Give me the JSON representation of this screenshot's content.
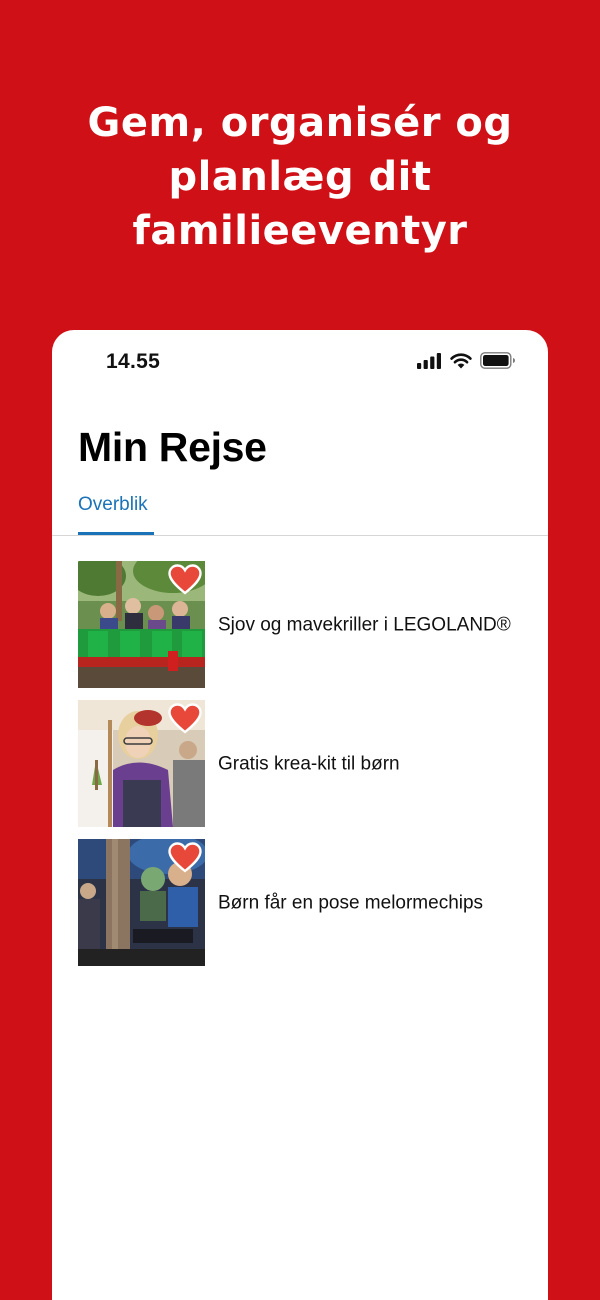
{
  "promo": {
    "headline_lines": [
      "Gem, organisér og",
      "planlæg dit",
      "familieeventyr"
    ]
  },
  "statusbar": {
    "time": "14.55",
    "icons": [
      "signal-icon",
      "wifi-icon",
      "battery-icon"
    ]
  },
  "screen": {
    "title": "Min Rejse",
    "tabs": [
      {
        "label": "Overblik",
        "active": true
      }
    ]
  },
  "saved_items": [
    {
      "title": "Sjov og mavekriller i LEGOLAND®",
      "favorited": true,
      "image": "rollercoaster-photo"
    },
    {
      "title": "Gratis krea-kit til børn",
      "favorited": true,
      "image": "girl-painting-photo"
    },
    {
      "title": "Børn får en pose melormechips",
      "favorited": true,
      "image": "children-forest-photo"
    }
  ],
  "colors": {
    "brand_red": "#cf1016",
    "tab_blue": "#1a73b8",
    "heart_red": "#e8483a"
  }
}
